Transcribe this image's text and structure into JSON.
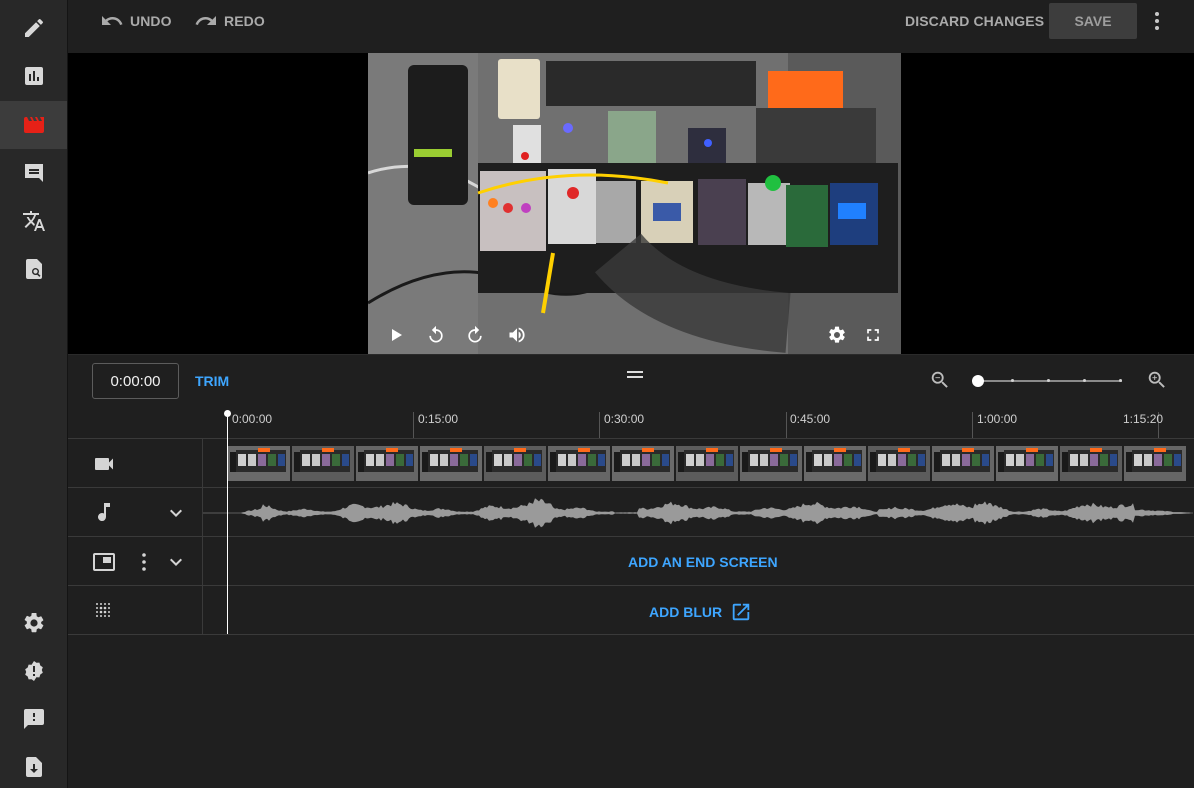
{
  "sidebar": {
    "items": [
      {
        "icon": "pencil-icon",
        "label": "Details"
      },
      {
        "icon": "analytics-icon",
        "label": "Analytics"
      },
      {
        "icon": "editor-clapper-icon",
        "label": "Editor",
        "active": true
      },
      {
        "icon": "comments-icon",
        "label": "Comments"
      },
      {
        "icon": "translate-icon",
        "label": "Subtitles"
      },
      {
        "icon": "copyright-search-icon",
        "label": "Copyright"
      }
    ],
    "bottom_items": [
      {
        "icon": "settings-icon"
      },
      {
        "icon": "alert-icon"
      },
      {
        "icon": "feedback-icon"
      },
      {
        "icon": "exit-icon"
      }
    ]
  },
  "toolbar": {
    "undo_label": "UNDO",
    "redo_label": "REDO",
    "discard_label": "DISCARD CHANGES",
    "save_label": "SAVE"
  },
  "timeline": {
    "current_time": "0:00:00",
    "trim_label": "TRIM",
    "zoom_level": 0,
    "ruler_labels": [
      "0:00:00",
      "0:15:00",
      "0:30:00",
      "0:45:00",
      "1:00:00",
      "1:15:20"
    ],
    "tracks": {
      "end_screen_label": "ADD AN END SCREEN",
      "blur_label": "ADD BLUR"
    }
  },
  "colors": {
    "accent": "#3ea6ff",
    "active_icon": "#e62117",
    "background": "#1f1f1f",
    "sidebar": "#282828"
  }
}
